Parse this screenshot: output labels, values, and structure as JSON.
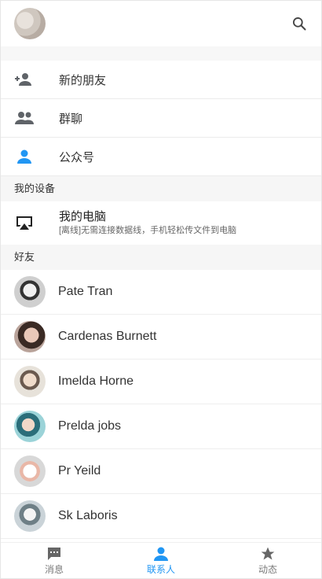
{
  "header": {
    "avatar_icon": "user-avatar",
    "search_icon": "search-icon"
  },
  "menu": [
    {
      "label": "新的朋友",
      "icon": "person-add-icon"
    },
    {
      "label": "群聊",
      "icon": "group-icon"
    },
    {
      "label": "公众号",
      "icon": "person-icon"
    }
  ],
  "my_devices": {
    "section_title": "我的设备",
    "device": {
      "title": "我的电脑",
      "subtitle": "[离线]无需连接数据线，手机轻松传文件到电脑",
      "icon": "airplay-icon"
    }
  },
  "friends": {
    "section_title": "好友",
    "items": [
      {
        "name": "Pate Tran"
      },
      {
        "name": "Cardenas Burnett"
      },
      {
        "name": "Imelda Horne"
      },
      {
        "name": "Prelda jobs"
      },
      {
        "name": "Pr Yeild"
      },
      {
        "name": "Sk Laboris"
      }
    ]
  },
  "tabbar": {
    "tabs": [
      {
        "label": "消息",
        "icon": "chat-icon",
        "active": false
      },
      {
        "label": "联系人",
        "icon": "contacts-icon",
        "active": true
      },
      {
        "label": "动态",
        "icon": "star-icon",
        "active": false
      }
    ],
    "active_color": "#2196f3",
    "inactive_color": "#7a7a7a"
  }
}
